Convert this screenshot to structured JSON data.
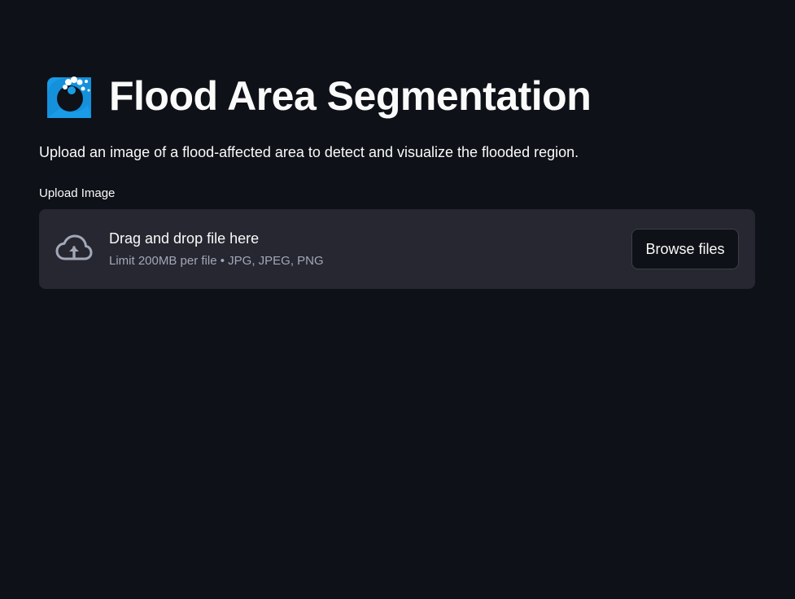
{
  "header": {
    "icon": "water-wave-icon",
    "title": "Flood Area Segmentation"
  },
  "main": {
    "description": "Upload an image of a flood-affected area to detect and visualize the flooded region.",
    "uploader": {
      "label": "Upload Image",
      "icon": "cloud-upload-icon",
      "drop_text": "Drag and drop file here",
      "limit_text": "Limit 200MB per file • JPG, JPEG, PNG",
      "browse_label": "Browse files"
    }
  },
  "colors": {
    "background": "#0e1117",
    "dropzone": "#262730",
    "text": "#fafafa",
    "muted_text": "#a3a8b8",
    "wave_blue": "#1a9be8"
  }
}
